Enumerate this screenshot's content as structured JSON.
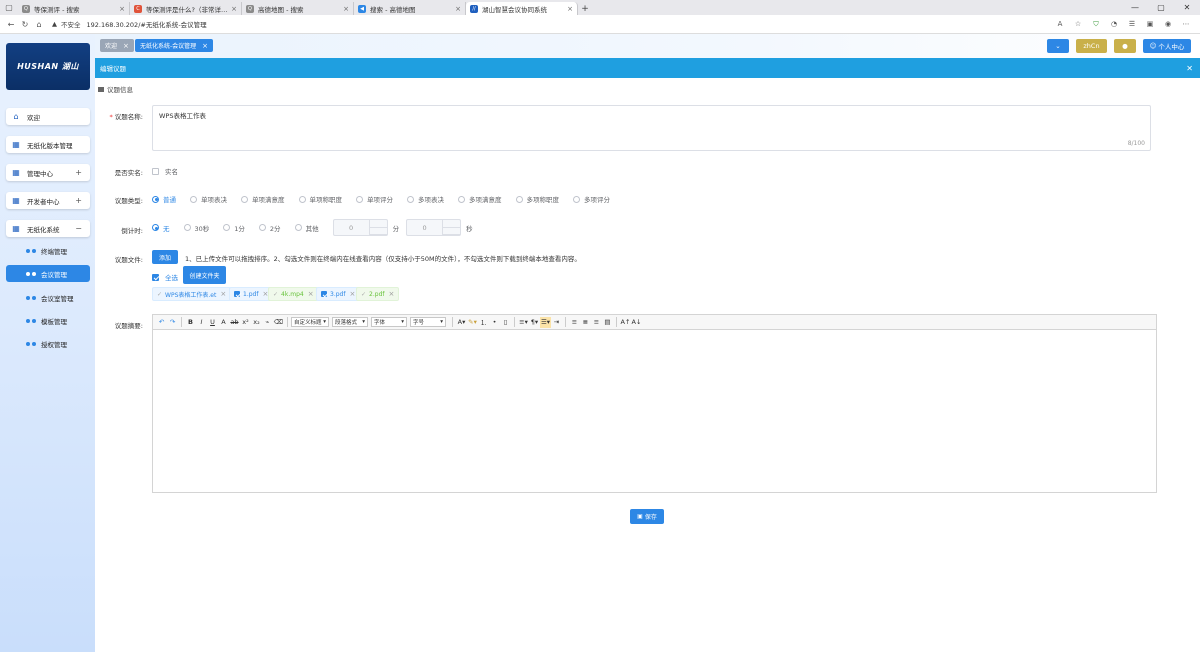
{
  "browser": {
    "tabs": [
      {
        "label": "等保测评 - 搜索",
        "fav": "Q",
        "fav_color": "#8a8a8a"
      },
      {
        "label": "等保测评是什么?（非常详细）零...",
        "fav": "C",
        "fav_color": "#e0533a"
      },
      {
        "label": "高德地图 - 搜索",
        "fav": "Q",
        "fav_color": "#8a8a8a"
      },
      {
        "label": "搜索 - 高德地图",
        "fav": "◀",
        "fav_color": "#2d87e5"
      },
      {
        "label": "湖山智慧会议协同系统",
        "fav": "//",
        "fav_color": "#1f5fbf"
      }
    ],
    "insecure_label": "不安全",
    "url": "192.168.30.202/#无纸化系统-会议管理"
  },
  "logo": {
    "text": "HUSHAN 湖山"
  },
  "sidebar": {
    "menu": [
      {
        "label": "欢迎",
        "icon": "home-icon",
        "glyph": "⌂",
        "expand": ""
      },
      {
        "label": "无纸化版本管理",
        "icon": "grid-icon",
        "glyph": "▦",
        "expand": ""
      },
      {
        "label": "管理中心",
        "icon": "grid-icon",
        "glyph": "▦",
        "expand": "+"
      },
      {
        "label": "开发者中心",
        "icon": "grid-icon",
        "glyph": "▦",
        "expand": "+"
      },
      {
        "label": "无纸化系统",
        "icon": "grid-icon",
        "glyph": "▦",
        "expand": "−"
      }
    ],
    "submenu": [
      {
        "label": "终端管理"
      },
      {
        "label": "会议管理"
      },
      {
        "label": "会议室管理"
      },
      {
        "label": "模板管理"
      },
      {
        "label": "授权管理"
      }
    ]
  },
  "page_tabs": {
    "welcome": "欢迎",
    "current": "无纸化系统-会议管理"
  },
  "topbar": {
    "lang": "zhCn",
    "user_center": "个人中心"
  },
  "panel": {
    "title": "编辑议题",
    "section": "议题信息"
  },
  "form": {
    "name_label": "议题名称:",
    "name_value": "WPS表格工作表",
    "name_counter": "8/100",
    "realname_label": "是否实名:",
    "realname_option": "实名",
    "type_label": "议题类型:",
    "type_options": [
      "普通",
      "单项表决",
      "单项满意度",
      "单项称职度",
      "单项评分",
      "多项表决",
      "多项满意度",
      "多项称职度",
      "多项评分"
    ],
    "type_selected": "普通",
    "countdown_label": "倒计时:",
    "countdown_options": [
      "无",
      "30秒",
      "1分",
      "2分",
      "其他"
    ],
    "countdown_selected": "无",
    "min_value": "0",
    "min_unit": "分",
    "sec_value": "0",
    "sec_unit": "秒",
    "file_label": "议题文件:",
    "add_button": "添加",
    "file_hint": "1、已上传文件可以拖拽排序。2、勾选文件则在终端内在线查看内容（仅支持小于50M的文件），不勾选文件则下载到终端本地查看内容。",
    "select_all": "全选",
    "create_folder": "创建文件夹",
    "files": [
      {
        "name": "WPS表格工作表.et",
        "checked": false,
        "style": "blue"
      },
      {
        "name": "1.pdf",
        "checked": true,
        "style": "blue"
      },
      {
        "name": "4k.mp4",
        "checked": false,
        "style": "green"
      },
      {
        "name": "3.pdf",
        "checked": true,
        "style": "blue"
      },
      {
        "name": "2.pdf",
        "checked": false,
        "style": "green"
      }
    ],
    "summary_label": "议题摘要:",
    "editor_selects": [
      "自定义标题",
      "段落格式",
      "字体",
      "字号"
    ],
    "save_button": "保存"
  }
}
